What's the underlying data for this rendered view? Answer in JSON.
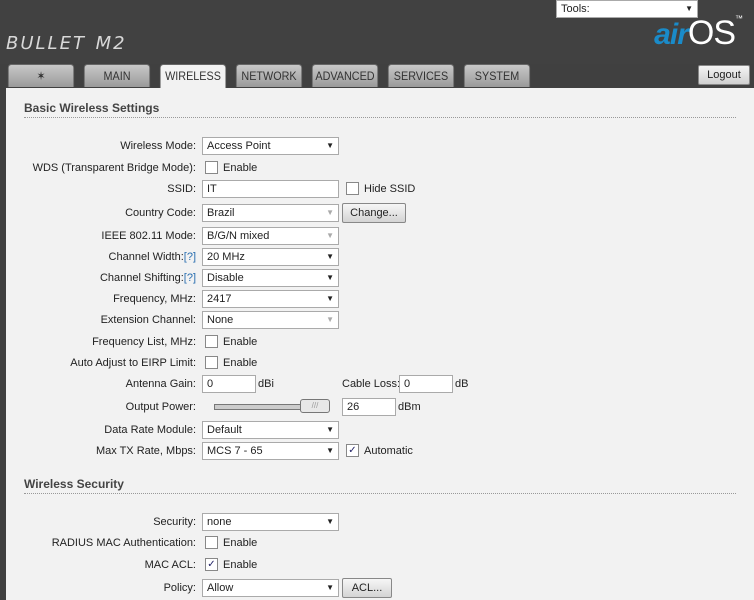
{
  "header": {
    "product": "BULLET",
    "model": "M2",
    "brand_air": "air",
    "brand_os": "OS",
    "tm": "™"
  },
  "tabs": [
    "MAIN",
    "WIRELESS",
    "NETWORK",
    "ADVANCED",
    "SERVICES",
    "SYSTEM"
  ],
  "active_tab": "WIRELESS",
  "tools": {
    "label": "Tools:",
    "logout": "Logout"
  },
  "basic": {
    "title": "Basic Wireless Settings",
    "wireless_mode": {
      "label": "Wireless Mode:",
      "value": "Access Point"
    },
    "wds": {
      "label": "WDS (Transparent Bridge Mode):",
      "option": "Enable",
      "checked": false
    },
    "ssid": {
      "label": "SSID:",
      "value": "IT",
      "hide": "Hide SSID",
      "hide_checked": false
    },
    "country": {
      "label": "Country Code:",
      "value": "Brazil",
      "button": "Change..."
    },
    "ieee": {
      "label": "IEEE 802.11 Mode:",
      "value": "B/G/N mixed"
    },
    "channel_width": {
      "label": "Channel Width:",
      "help": "[?]",
      "value": "20 MHz"
    },
    "channel_shift": {
      "label": "Channel Shifting:",
      "help": "[?]",
      "value": "Disable"
    },
    "frequency": {
      "label": "Frequency, MHz:",
      "value": "2417"
    },
    "ext_channel": {
      "label": "Extension Channel:",
      "value": "None"
    },
    "freq_list": {
      "label": "Frequency List, MHz:",
      "option": "Enable",
      "checked": false
    },
    "eirp": {
      "label": "Auto Adjust to EIRP Limit:",
      "option": "Enable",
      "checked": false
    },
    "antenna_gain": {
      "label": "Antenna Gain:",
      "value": "0",
      "unit": "dBi"
    },
    "cable_loss": {
      "label": "Cable Loss:",
      "value": "0",
      "unit": "dB"
    },
    "output_power": {
      "label": "Output Power:",
      "value": "26",
      "unit": "dBm",
      "slider_fraction": 1.0
    },
    "data_rate": {
      "label": "Data Rate Module:",
      "value": "Default"
    },
    "max_tx": {
      "label": "Max TX Rate, Mbps:",
      "value": "MCS 7 - 65",
      "auto": "Automatic",
      "auto_checked": true
    }
  },
  "security": {
    "title": "Wireless Security",
    "security": {
      "label": "Security:",
      "value": "none"
    },
    "radius": {
      "label": "RADIUS MAC Authentication:",
      "option": "Enable",
      "checked": false
    },
    "mac_acl": {
      "label": "MAC ACL:",
      "option": "Enable",
      "checked": true
    },
    "policy": {
      "label": "Policy:",
      "value": "Allow",
      "button": "ACL..."
    }
  }
}
